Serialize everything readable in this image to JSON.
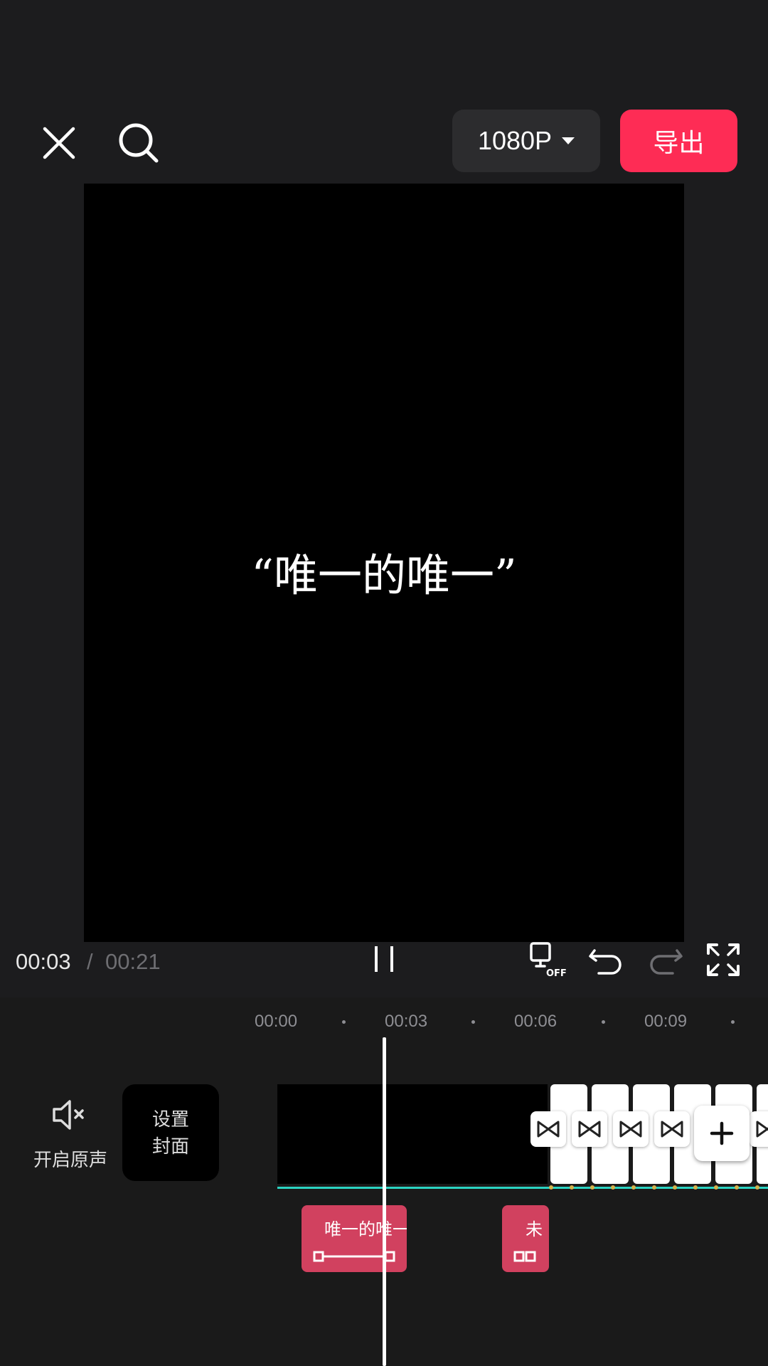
{
  "header": {
    "resolution": "1080P",
    "export_label": "导出"
  },
  "preview": {
    "subtitle": "“唯一的唯一”"
  },
  "playback": {
    "current_time": "00:03",
    "separator": "/",
    "total_time": "00:21"
  },
  "timeline": {
    "ruler_labels": [
      "00:00",
      "00:03",
      "00:06",
      "00:09"
    ],
    "audio_toggle_label": "开启原声",
    "cover_label_line1": "设置",
    "cover_label_line2": "封面",
    "text_clips": [
      {
        "label": "唯一的唯一"
      },
      {
        "label": "未"
      }
    ]
  },
  "colors": {
    "accent": "#fe2c55",
    "text_clip": "#d1415f",
    "track_line": "#2bd3c2",
    "background": "#1c1c1e"
  },
  "icons": {
    "close": "close-icon",
    "search": "search-icon",
    "pause": "pause-icon",
    "keyframe": "keyframe-off-icon",
    "undo": "undo-icon",
    "redo": "redo-icon",
    "fullscreen": "fullscreen-icon",
    "mute": "speaker-muted-icon",
    "transition": "transition-icon",
    "add": "plus-icon"
  }
}
